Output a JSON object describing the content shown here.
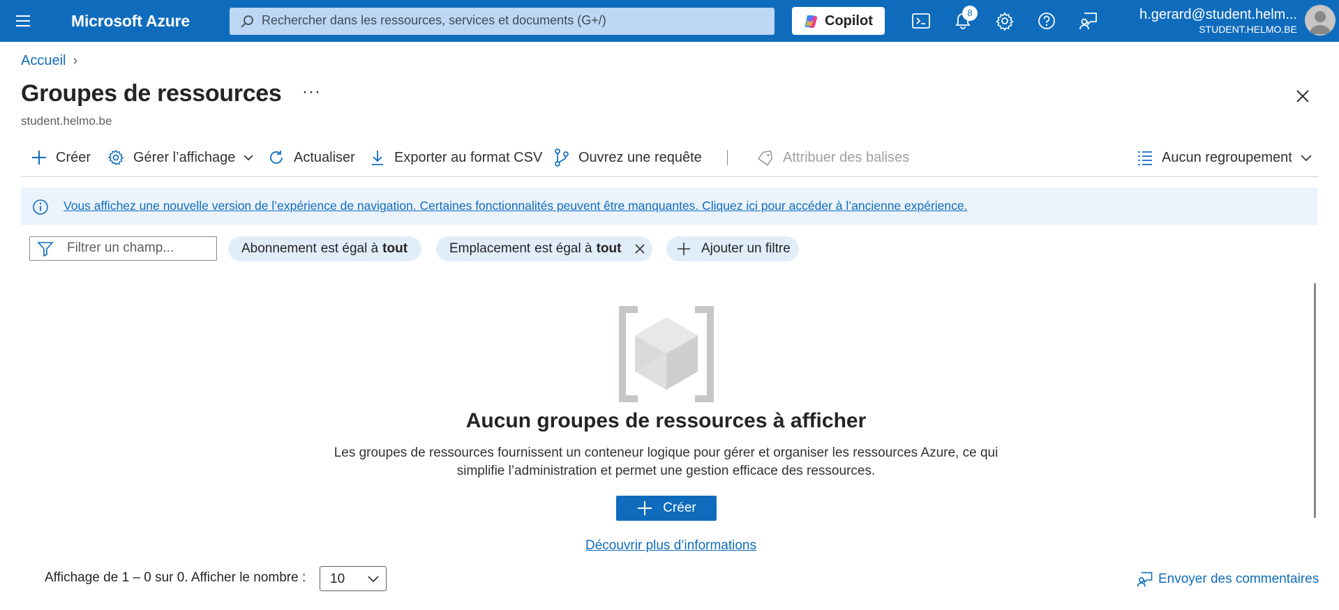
{
  "topbar": {
    "brand": "Microsoft Azure",
    "search_placeholder": "Rechercher dans les ressources, services et documents (G+/)",
    "copilot_label": "Copilot",
    "notification_count": "8",
    "user_name": "h.gerard@student.helm...",
    "user_directory": "STUDENT.HELMO.BE",
    "icons": [
      "menu-icon",
      "search-icon",
      "copilot-icon",
      "cloud-shell-icon",
      "bell-icon",
      "gear-icon",
      "help-icon",
      "feedback-icon",
      "avatar"
    ],
    "color": "#0f6cbd"
  },
  "breadcrumb": {
    "home": "Accueil"
  },
  "page": {
    "title": "Groupes de ressources",
    "more": "···",
    "subtitle": "student.helmo.be"
  },
  "toolbar": {
    "create": "Créer",
    "manage_view": "Gérer l’affichage",
    "refresh": "Actualiser",
    "export_csv": "Exporter au format CSV",
    "open_query": "Ouvrez une requête",
    "assign_tags": "Attribuer des balises",
    "grouping": "Aucun regroupement"
  },
  "info_banner": {
    "text": "Vous affichez une nouvelle version de l’expérience de navigation. Certaines fonctionnalités peuvent être manquantes. Cliquez ici pour accéder à l’ancienne expérience."
  },
  "filters": {
    "placeholder": "Filtrer un champ...",
    "subscription": {
      "field": "Abonnement",
      "op": "est égal à",
      "value": "tout"
    },
    "location": {
      "field": "Emplacement",
      "op": "est égal à",
      "value": "tout"
    },
    "add_filter": "Ajouter un filtre"
  },
  "empty_state": {
    "title": "Aucun groupes de ressources à afficher",
    "description": "Les groupes de ressources fournissent un conteneur logique pour gérer et organiser les ressources Azure, ce qui simplifie l’administration et permet une gestion efficace des ressources.",
    "create": "Créer",
    "learn_more": "Découvrir plus d’informations"
  },
  "footer": {
    "pager_text": "Affichage de 1 – 0 sur 0. Afficher le nombre :",
    "page_size": "10",
    "feedback": "Envoyer des commentaires"
  }
}
